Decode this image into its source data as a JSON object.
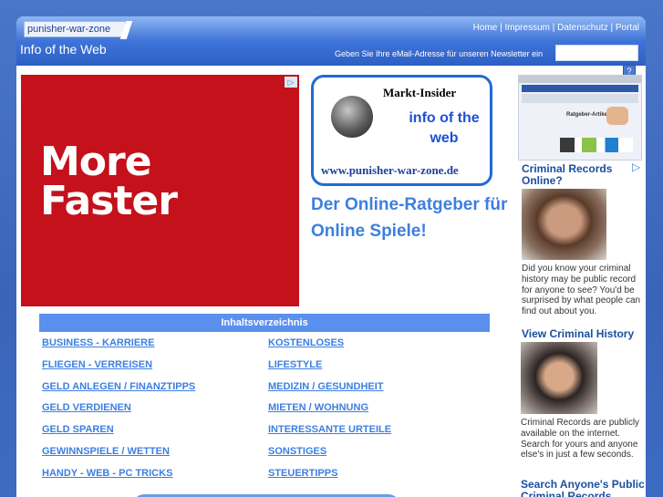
{
  "header": {
    "logo": "punisher-war-zone",
    "tagline": "Info of the Web",
    "nav": [
      "Home",
      "Impressum",
      "Datenschutz",
      "Portal"
    ],
    "nav_sep": " | ",
    "newsletter_label": "Geben Sie Ihre eMail-Adresse für unseren Newsletter ein",
    "newsletter_value": "",
    "help_glyph": "?"
  },
  "ad_big": {
    "badge": "▷",
    "headline": "More Faster"
  },
  "banner": {
    "name": "Markt-Insider",
    "info": "info of the web",
    "url": "www.punisher-war-zone.de",
    "slogan": "Der Online-Ratgeber für Online Spiele!"
  },
  "toc": {
    "title": "Inhaltsverzeichnis",
    "items": [
      "BUSINESS - KARRIERE",
      "KOSTENLOSES",
      "FLIEGEN - VERREISEN",
      "LIFESTYLE",
      "GELD ANLEGEN / FINANZTIPPS",
      "MEDIZIN / GESUNDHEIT",
      "GELD VERDIENEN",
      "MIETEN / WOHNUNG",
      "GELD SPAREN",
      "INTERESSANTE URTEILE",
      "GEWINNSPIELE / WETTEN",
      "SONSTIGES",
      "HANDY - WEB - PC TRICKS",
      "STEUERTIPPS"
    ]
  },
  "thumbnail": {
    "title": "Ratgeber-Artikel"
  },
  "side_ads": {
    "badge": "▷",
    "ad1_title": "Criminal Records Online?",
    "ad1_body": "Did you know your criminal history may be public record for anyone to see? You'd be surprised by what people can find out about you.",
    "ad2_title": "View Criminal History",
    "ad2_body": "Criminal Records are publicly available on the internet. Search for yours and anyone else's in just a few seconds.",
    "ad3_title": "Search Anyone's Public Criminal Records"
  }
}
